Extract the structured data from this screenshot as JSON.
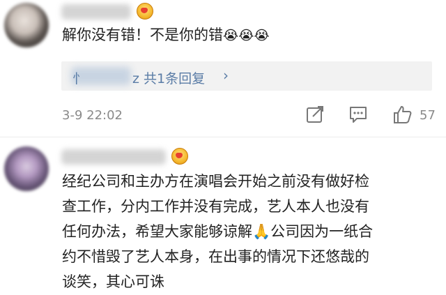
{
  "comments": [
    {
      "text": "解你没有错！不是你的错",
      "emoji": "😭😭😭",
      "reply_prefix": "忄",
      "reply_suffix": "z 共1条回复",
      "time": "3-9 22:02",
      "likes": "57"
    },
    {
      "lines": [
        "经纪公司和主办方在演唱会开始之前没有做好检",
        "查工作，分内工作并没有完成，艺人本人也没有",
        "任何办法，希望大家能够谅解🙏公司因为一纸合",
        "约不惜毁了艺人本身，在出事的情况下还悠哉的",
        "谈笑，其心可诛"
      ]
    }
  ],
  "icons": {
    "share": "share-icon",
    "comment": "comment-icon",
    "like": "thumbs-up-icon",
    "chevron": "chevron-right-icon",
    "badge": "vip-crown-badge-icon"
  },
  "colors": {
    "link": "#5a7ca6",
    "meta": "#8a8a8a",
    "text": "#222222",
    "reply_bg": "#f2f2f2"
  }
}
